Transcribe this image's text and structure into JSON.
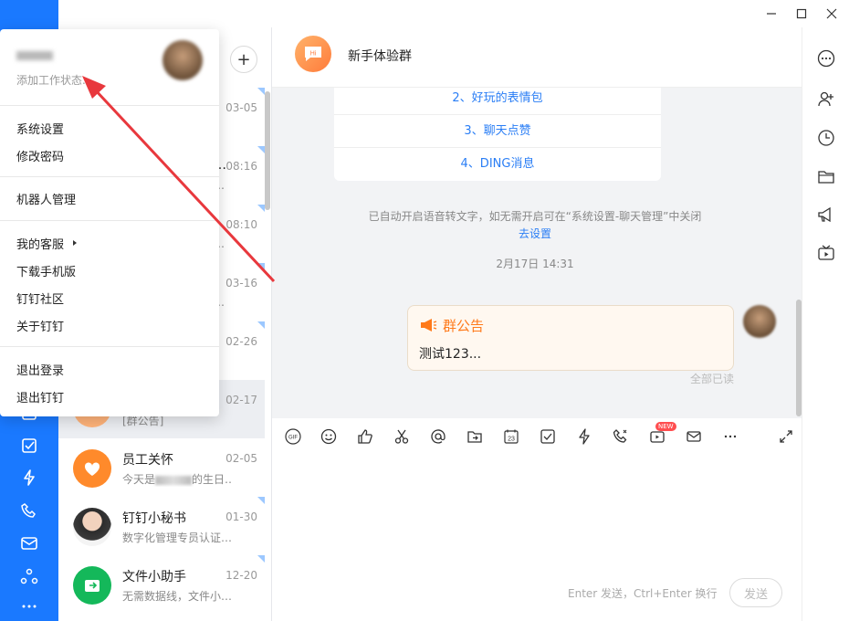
{
  "dropdown": {
    "status_placeholder": "添加工作状态...",
    "items": [
      "系统设置",
      "修改密码",
      "机器人管理",
      "我的客服",
      "下载手机版",
      "钉钉社区",
      "关于钉钉",
      "退出登录",
      "退出钉钉"
    ]
  },
  "conversation_list": {
    "add_label": "+",
    "items": [
      {
        "title": "",
        "subtitle": "",
        "time": "03-05"
      },
      {
        "title": "…",
        "subtitle": "…",
        "time": "08:16"
      },
      {
        "title": "",
        "subtitle": "…",
        "time": "08:10"
      },
      {
        "title": "",
        "subtitle": "…",
        "time": "03-16"
      },
      {
        "title": "",
        "subtitle": "…",
        "time": "02-26"
      },
      {
        "title": "",
        "subtitle": "[群公告]",
        "time": "02-17"
      },
      {
        "title": "员工关怀",
        "subtitle_prefix": "今天是",
        "subtitle_suffix": "的生日…",
        "time": "02-05"
      },
      {
        "title": "钉钉小秘书",
        "subtitle": "数字化管理专员认证…",
        "time": "01-30"
      },
      {
        "title": "文件小助手",
        "subtitle": "无需数据线，文件小…",
        "time": "12-20"
      }
    ]
  },
  "chat": {
    "group_name": "新手体验群",
    "group_avatar_text": "Hi",
    "menu_items": [
      "2、好玩的表情包",
      "3、聊天点赞",
      "4、DING消息"
    ],
    "system_tip": "已自动开启语音转文字，如无需开启可在“系统设置-聊天管理”中关闭",
    "system_link": "去设置",
    "date_tip": "2月17日 14:31",
    "notice_title": "群公告",
    "notice_text": "测试123...",
    "read_status": "全部已读"
  },
  "toolbar": {
    "new_badge": "NEW",
    "gif_label": "GIF",
    "calendar_label": "23"
  },
  "input": {
    "hint": "Enter 发送，Ctrl+Enter 换行",
    "send_label": "发送"
  },
  "colors": {
    "rail": "#1a79ff",
    "link": "#2a7ef5",
    "notice_orange": "#ff7a1a",
    "arrow_red": "#e8383d"
  }
}
